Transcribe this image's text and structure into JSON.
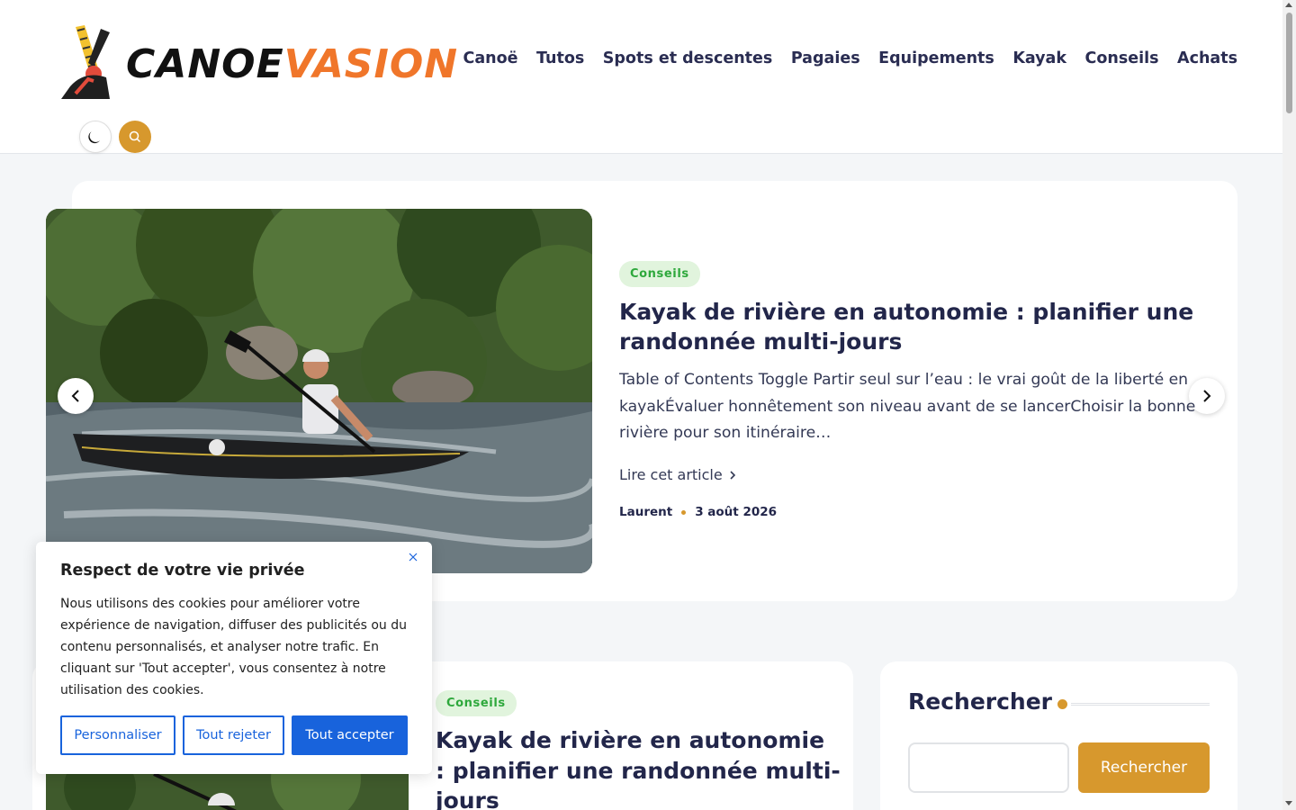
{
  "header": {
    "logo": {
      "part1": "CANOE",
      "part2": "VASION"
    },
    "nav": [
      "Canoë",
      "Tutos",
      "Spots et descentes",
      "Pagaies",
      "Equipements",
      "Kayak",
      "Conseils",
      "Achats"
    ],
    "icons": {
      "dark_mode": "moon-icon",
      "search": "search-icon"
    }
  },
  "hero": {
    "tag": "Conseils",
    "title": "Kayak de rivière en autonomie : planifier une randonnée multi-jours",
    "excerpt": "Table of Contents Toggle Partir seul sur l’eau : le vrai goût de la liberté en kayakÉvaluer honnêtement son niveau avant de se lancerChoisir la bonne rivière pour son itinéraire…",
    "read_more": "Lire cet article",
    "author": "Laurent",
    "date": "3 août 2026",
    "image": "kayaker-whitewater-photo"
  },
  "post": {
    "tag": "Conseils",
    "title": "Kayak de rivière en autonomie : planifier une randonnée multi-jours"
  },
  "sidebar": {
    "widget_title": "Rechercher",
    "search_button": "Rechercher",
    "search_placeholder": ""
  },
  "cookie": {
    "title": "Respect de votre vie privée",
    "text": "Nous utilisons des cookies pour améliorer votre expérience de navigation, diffuser des publicités ou du contenu personnalisés, et analyser notre trafic. En cliquant sur 'Tout accepter', vous consentez à notre utilisation des cookies.",
    "customize": "Personnaliser",
    "reject": "Tout rejeter",
    "accept": "Tout accepter"
  },
  "colors": {
    "accent": "#d7982d",
    "logo_orange": "#f0762a",
    "tag_green": "#2ea83c",
    "cookie_blue": "#1863dc",
    "text_dark": "#22264a"
  }
}
